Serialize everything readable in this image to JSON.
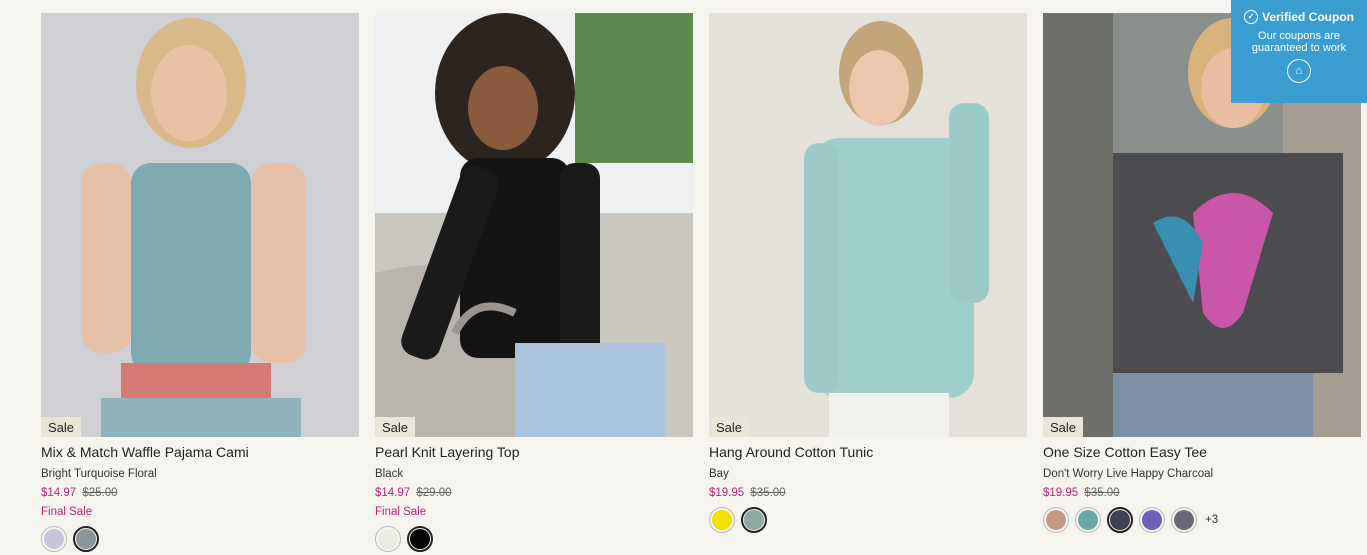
{
  "products": [
    {
      "title": "Mix & Match Waffle Pajama Cami",
      "color": "Bright Turquoise Floral",
      "price": "$14.97",
      "original_price": "$25.00",
      "badge": "Sale",
      "final_sale": "Final Sale",
      "swatches": [
        {
          "color": "#c9c3dc",
          "selected": false
        },
        {
          "color": "#8b9599",
          "selected": true
        }
      ],
      "more": ""
    },
    {
      "title": "Pearl Knit Layering Top",
      "color": "Black",
      "price": "$14.97",
      "original_price": "$29.00",
      "badge": "Sale",
      "final_sale": "Final Sale",
      "swatches": [
        {
          "color": "#ecebe3",
          "selected": false
        },
        {
          "color": "#050505",
          "selected": true
        }
      ],
      "more": ""
    },
    {
      "title": "Hang Around Cotton Tunic",
      "color": "Bay",
      "price": "$19.95",
      "original_price": "$35.00",
      "badge": "Sale",
      "final_sale": "",
      "swatches": [
        {
          "color": "#f4e100",
          "selected": false
        },
        {
          "color": "#8fa8a1",
          "selected": true
        }
      ],
      "more": ""
    },
    {
      "title": "One Size Cotton Easy Tee",
      "color": "Don't Worry Live Happy Charcoal",
      "price": "$19.95",
      "original_price": "$35.00",
      "badge": "Sale",
      "final_sale": "",
      "swatches": [
        {
          "color": "#c79a86",
          "selected": false
        },
        {
          "color": "#6aa7a6",
          "selected": false
        },
        {
          "color": "#3f3f52",
          "selected": true
        },
        {
          "color": "#6f5fb5",
          "selected": false
        },
        {
          "color": "#6b6a78",
          "selected": false
        }
      ],
      "more": "+3"
    }
  ],
  "coupon": {
    "heading": "Verified Coupon",
    "subtext": "Our coupons are guaranteed to work",
    "icon": "tag-icon"
  }
}
